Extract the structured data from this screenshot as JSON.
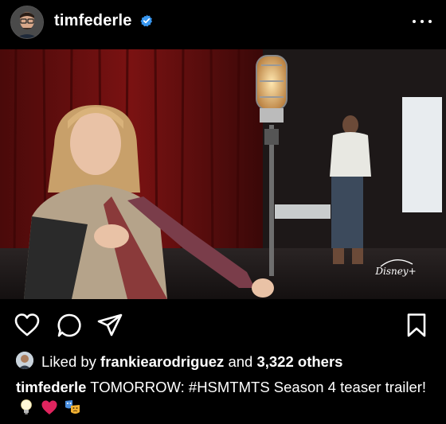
{
  "post": {
    "username": "timfederle",
    "verified": true,
    "menu_icon": "more-horizontal-icon"
  },
  "media": {
    "watermark": "Disney+"
  },
  "actions": {
    "like_icon": "heart-outline-icon",
    "comment_icon": "comment-bubble-icon",
    "share_icon": "paper-plane-icon",
    "save_icon": "bookmark-outline-icon"
  },
  "likes": {
    "prefix": "Liked by",
    "liker": "frankiearodriguez",
    "connector": "and",
    "others": "3,322 others"
  },
  "caption": {
    "username": "timfederle",
    "text": "TOMORROW: #HSMTMTS Season 4 teaser trailer!",
    "emojis": [
      "lightbulb-emoji",
      "red-heart-emoji",
      "performing-arts-emoji"
    ]
  },
  "colors": {
    "background": "#000000",
    "verified_badge": "#3897f0",
    "heart_emoji": "#e0245e"
  }
}
